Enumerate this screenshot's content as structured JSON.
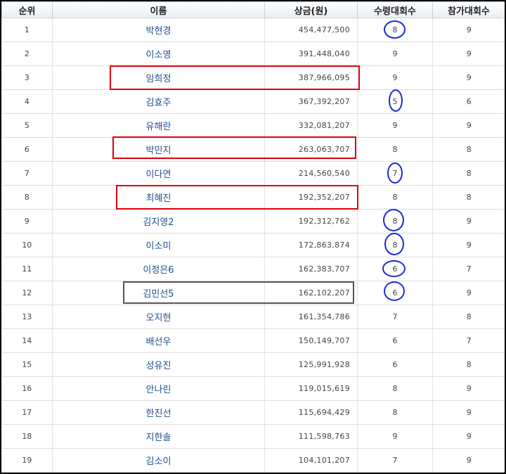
{
  "headers": {
    "rank": "순위",
    "name": "이름",
    "prize": "상금(원)",
    "wins": "수령대회수",
    "entries": "참가대회수"
  },
  "rows": [
    {
      "rank": "1",
      "name": "박현경",
      "prize": "454,477,500",
      "wins": "8",
      "entries": "9"
    },
    {
      "rank": "2",
      "name": "이소영",
      "prize": "391,448,040",
      "wins": "9",
      "entries": "9"
    },
    {
      "rank": "3",
      "name": "임희정",
      "prize": "387,966,095",
      "wins": "9",
      "entries": "9"
    },
    {
      "rank": "4",
      "name": "김효주",
      "prize": "367,392,207",
      "wins": "5",
      "entries": "6"
    },
    {
      "rank": "5",
      "name": "유해란",
      "prize": "332,081,207",
      "wins": "9",
      "entries": "9"
    },
    {
      "rank": "6",
      "name": "박민지",
      "prize": "263,063,707",
      "wins": "8",
      "entries": "8"
    },
    {
      "rank": "7",
      "name": "이다연",
      "prize": "214,560,540",
      "wins": "7",
      "entries": "8"
    },
    {
      "rank": "8",
      "name": "최혜진",
      "prize": "192,352,207",
      "wins": "8",
      "entries": "8"
    },
    {
      "rank": "9",
      "name": "김지영2",
      "prize": "192,312,762",
      "wins": "8",
      "entries": "9"
    },
    {
      "rank": "10",
      "name": "이소미",
      "prize": "172,863,874",
      "wins": "8",
      "entries": "9"
    },
    {
      "rank": "11",
      "name": "이정은6",
      "prize": "162,383,707",
      "wins": "6",
      "entries": "7"
    },
    {
      "rank": "12",
      "name": "김민선5",
      "prize": "162,102,207",
      "wins": "6",
      "entries": "9"
    },
    {
      "rank": "13",
      "name": "오지현",
      "prize": "161,354,786",
      "wins": "7",
      "entries": "8"
    },
    {
      "rank": "14",
      "name": "배선우",
      "prize": "150,149,707",
      "wins": "6",
      "entries": "7"
    },
    {
      "rank": "15",
      "name": "성유진",
      "prize": "125,991,928",
      "wins": "6",
      "entries": "8"
    },
    {
      "rank": "16",
      "name": "안나린",
      "prize": "119,015,619",
      "wins": "8",
      "entries": "9"
    },
    {
      "rank": "17",
      "name": "한진선",
      "prize": "115,694,429",
      "wins": "8",
      "entries": "9"
    },
    {
      "rank": "18",
      "name": "지한솔",
      "prize": "111,598,763",
      "wins": "9",
      "entries": "9"
    },
    {
      "rank": "19",
      "name": "김소이",
      "prize": "104,101,207",
      "wins": "7",
      "entries": "9"
    }
  ],
  "colors": {
    "header_bg": "#e9edf3",
    "name_text": "#1f4e8c",
    "highlight_red": "#e0000a",
    "highlight_blue": "#1a2ad8",
    "highlight_gray": "#555555"
  }
}
